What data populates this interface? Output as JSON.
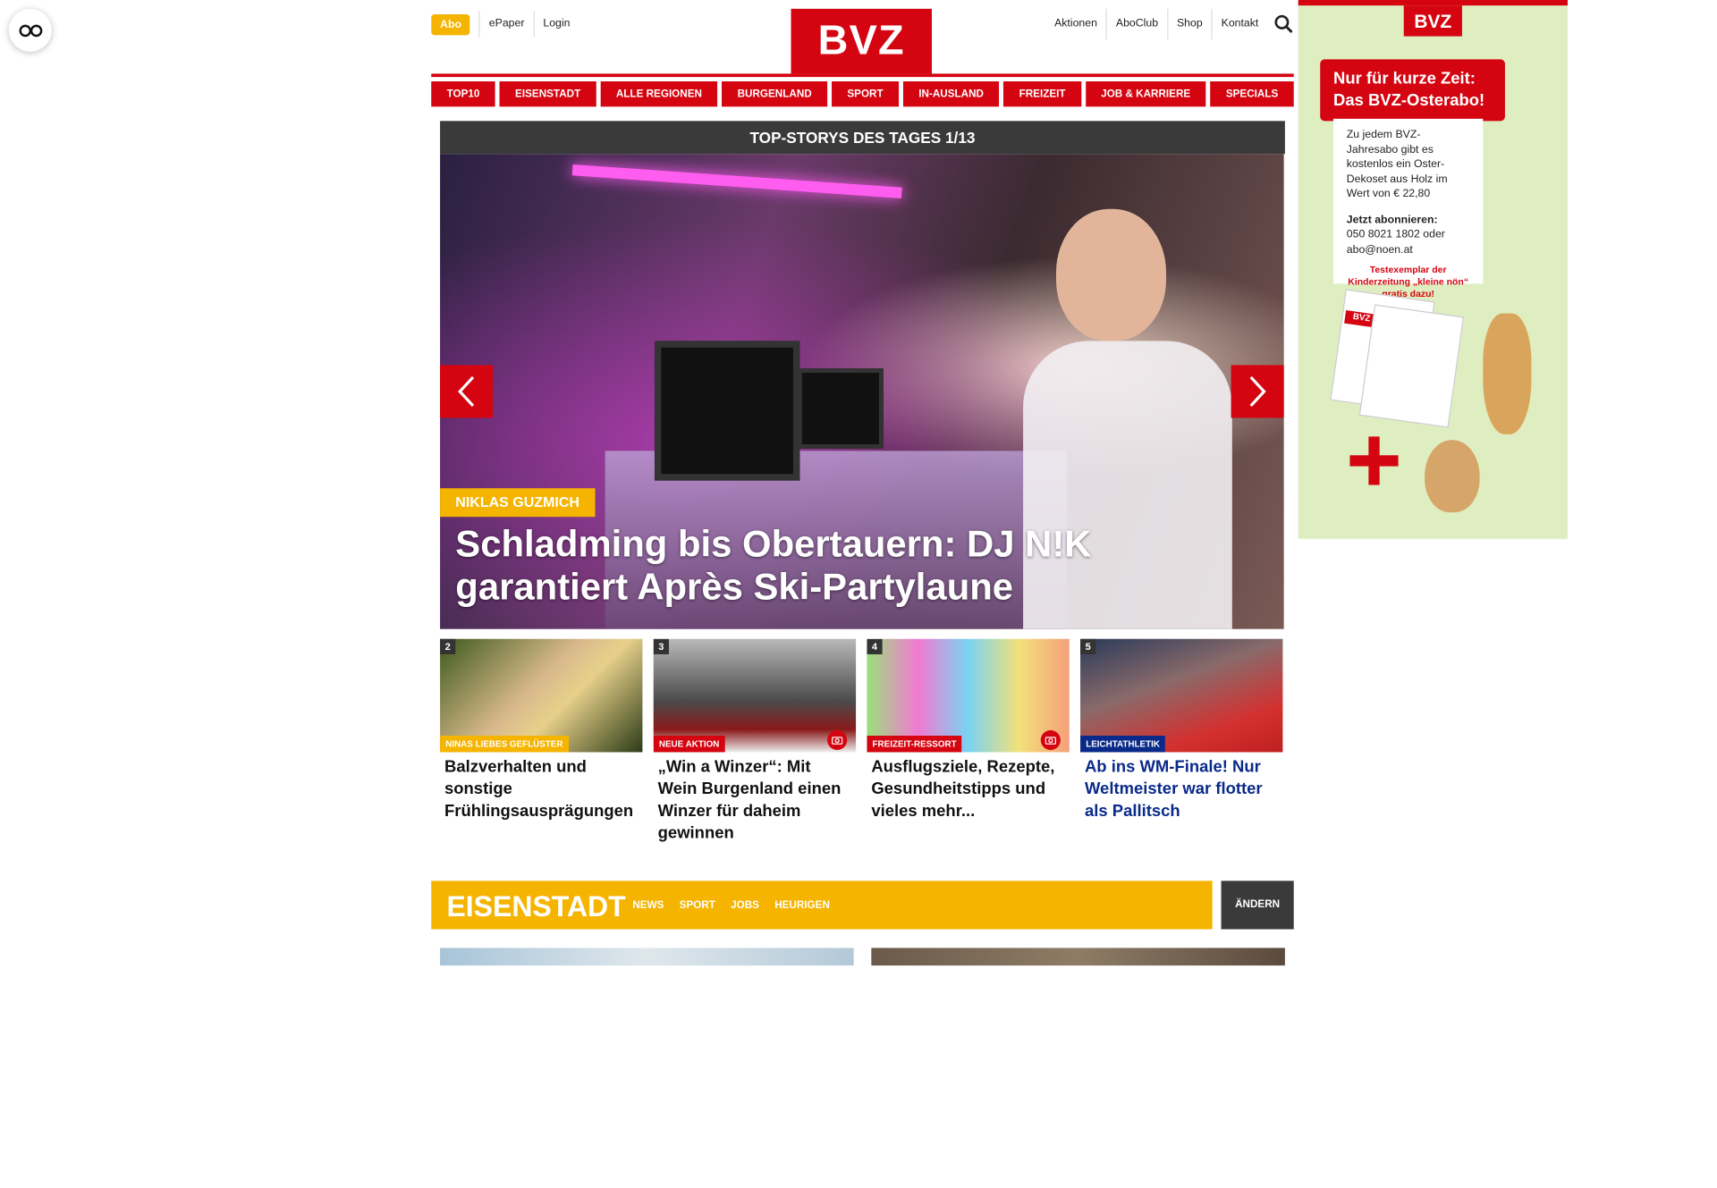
{
  "header": {
    "abo_label": "Abo",
    "epaper_label": "ePaper",
    "login_label": "Login",
    "logo_text": "BVZ",
    "right_links": [
      "Aktionen",
      "AboClub",
      "Shop",
      "Kontakt"
    ]
  },
  "nav": {
    "items": [
      "TOP10",
      "EISENSTADT",
      "ALLE REGIONEN",
      "BURGENLAND",
      "SPORT",
      "IN-AUSLAND",
      "FREIZEIT",
      "JOB & KARRIERE",
      "SPECIALS"
    ]
  },
  "hero": {
    "header": "TOP-STORYS DES TAGES 1/13",
    "tag": "NIKLAS GUZMICH",
    "title": "Schladming bis Obertauern: DJ N!K garantiert Après Ski-Partylaune"
  },
  "teasers": [
    {
      "num": "2",
      "category": "NINAS LIEBES GEFLÜSTER",
      "category_color": "#f5b400",
      "title": "Balzverhalten und sonstige Frühlingsausprägungen",
      "camera": false
    },
    {
      "num": "3",
      "category": "NEUE AKTION",
      "category_color": "#d40511",
      "title": "„Win a Winzer“: Mit Wein Burgenland einen Winzer für daheim gewinnen",
      "camera": true
    },
    {
      "num": "4",
      "category": "FREIZEIT-RESSORT",
      "category_color": "#d40511",
      "title": "Ausflugsziele, Rezepte, Gesundheitstipps und vieles mehr...",
      "camera": true
    },
    {
      "num": "5",
      "category": "LEICHTATHLETIK",
      "category_color": "#0a2a8a",
      "title": "Ab ins WM-Finale! Nur Weltmeister war flotter als Pallitsch",
      "camera": false
    }
  ],
  "region": {
    "name": "EISENSTADT",
    "links": [
      "NEWS",
      "SPORT",
      "JOBS",
      "HEURIGEN"
    ],
    "change_label": "ÄNDERN"
  },
  "ad": {
    "logo": "BVZ",
    "banner_line1": "Nur für kurze Zeit:",
    "banner_line2": "Das BVZ-Osterabo!",
    "body": "Zu jedem BVZ-Jahresabo gibt es kostenlos ein Oster-Dekoset aus Holz im Wert von € 22,80",
    "cta_title": "Jetzt abonnieren:",
    "cta_body": "050 8021 1802 oder abo@noen.at",
    "note": "Testexemplar der Kinderzeitung „kleine nön“ gratis dazu!",
    "mag_label": "BVZ"
  },
  "colors": {
    "brand_red": "#d40511",
    "accent_yellow": "#f5b400",
    "dark_gray": "#3a3a3a"
  }
}
